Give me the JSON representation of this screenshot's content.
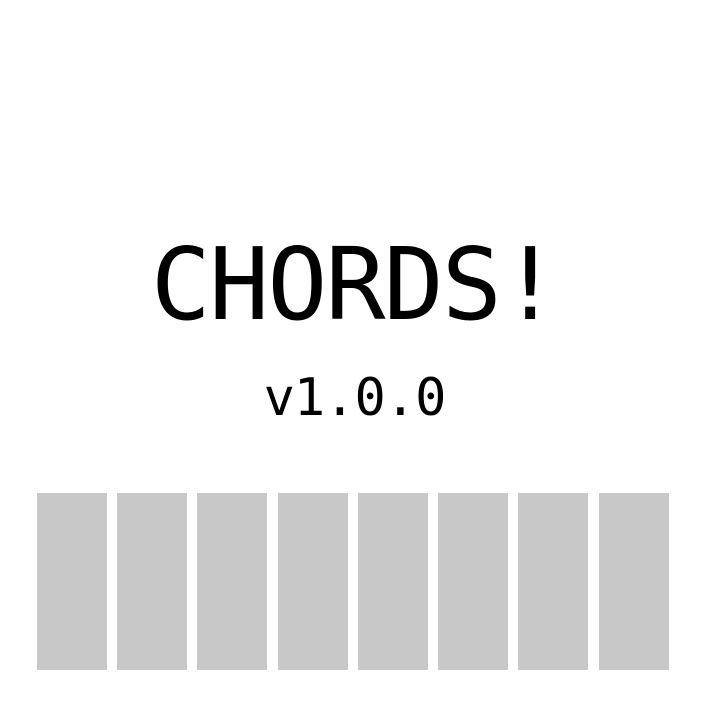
{
  "app": {
    "title": "CHORDS!",
    "version": "v1.0.0"
  },
  "pads": {
    "count": 8,
    "color": "#c8c8c8"
  },
  "colors": {
    "background": "#ffffff",
    "text": "#000000",
    "pad": "#c8c8c8"
  }
}
